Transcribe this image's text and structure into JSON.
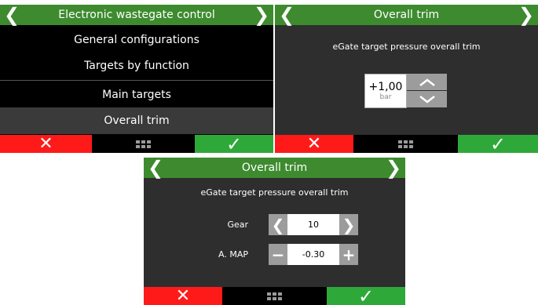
{
  "panel1": {
    "title": "Electronic wastegate control",
    "menu": [
      "General configurations",
      "Targets by function",
      "Main targets",
      "Overall trim"
    ]
  },
  "panel2": {
    "title": "Overall trim",
    "description": "eGate target pressure overall trim",
    "value": "+1,00",
    "unit": "bar"
  },
  "panel3": {
    "title": "Overall trim",
    "description": "eGate target pressure overall trim",
    "gear_label": "Gear",
    "gear_value": "10",
    "map_label": "A. MAP",
    "map_value": "-0.30"
  },
  "icons": {
    "left": "❮",
    "right": "❯",
    "cancel": "✕",
    "confirm": "✓",
    "minus": "−",
    "plus": "+"
  },
  "colors": {
    "header": "#3d8b2e",
    "cancel": "#ff1a1a",
    "confirm": "#2fa83a",
    "panel": "#2e2e2e"
  }
}
